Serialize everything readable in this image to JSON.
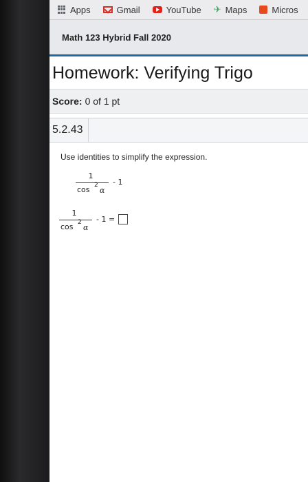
{
  "bookmarks": [
    {
      "label": "Apps",
      "icon": "apps-grid-icon"
    },
    {
      "label": "Gmail",
      "icon": "gmail-icon"
    },
    {
      "label": "YouTube",
      "icon": "youtube-icon"
    },
    {
      "label": "Maps",
      "icon": "maps-icon"
    },
    {
      "label": "Micros",
      "icon": "microsoft-icon"
    }
  ],
  "course": {
    "title": "Math 123 Hybrid Fall 2020"
  },
  "homework": {
    "title": "Homework: Verifying Trigo"
  },
  "score": {
    "label": "Score:",
    "value": "0 of 1 pt"
  },
  "question": {
    "number": "5.2.43",
    "instruction": "Use identities to simplify the expression.",
    "expr_numerator": "1",
    "expr_denominator": "cos",
    "expr_exponent": "2",
    "expr_variable": "α",
    "expr_tail": "- 1",
    "answer_tail": "- 1 =",
    "answer_value": ""
  },
  "colors": {
    "accent": "#1d6aa6"
  }
}
